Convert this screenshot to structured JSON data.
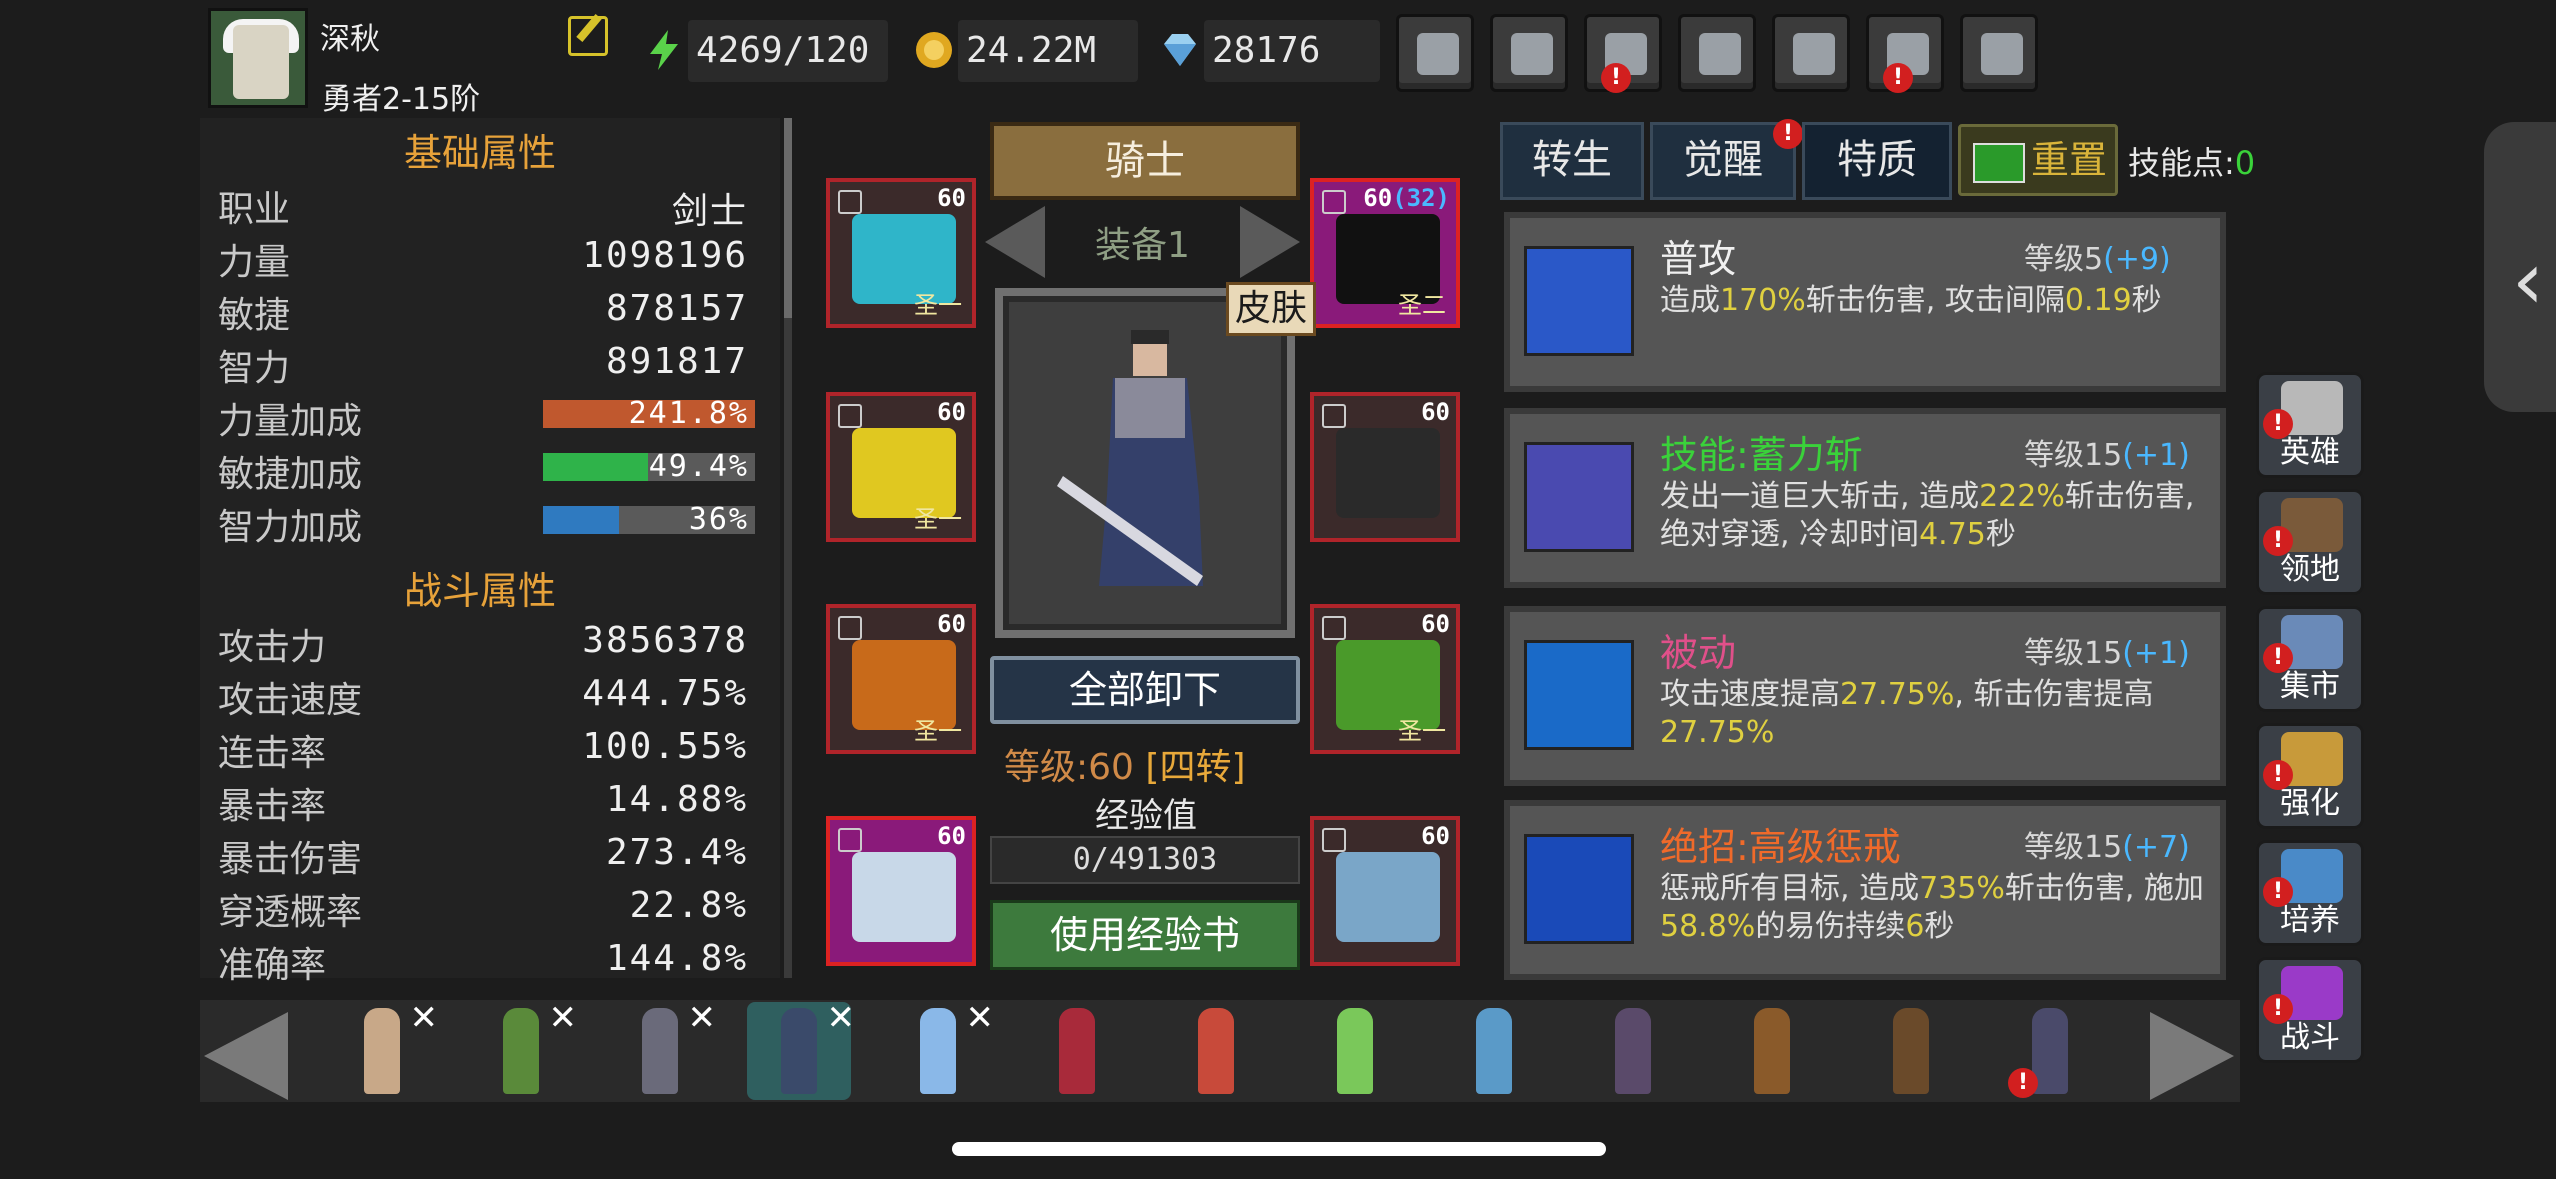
{
  "player": {
    "name": "深秋",
    "rank": "勇者2-15阶"
  },
  "resources": [
    {
      "icon": "energy-icon",
      "value": "4269/120"
    },
    {
      "icon": "gold-icon",
      "value": "24.22M"
    },
    {
      "icon": "diamond-icon",
      "value": "28176"
    }
  ],
  "top_buttons": [
    {
      "name": "shop-button",
      "icon": "cart-icon",
      "alert": false
    },
    {
      "name": "mail-button",
      "icon": "mail-icon",
      "alert": false
    },
    {
      "name": "gamepad-button",
      "icon": "gamepad-icon",
      "alert": true
    },
    {
      "name": "settings-button",
      "icon": "gear-icon",
      "alert": false
    },
    {
      "name": "color-wheel-button",
      "icon": "color-wheel-icon",
      "alert": false
    },
    {
      "name": "fireworks-button",
      "icon": "fireworks-icon",
      "alert": true
    },
    {
      "name": "battle-button",
      "icon": "crossed-swords-icon",
      "alert": false
    }
  ],
  "stats": {
    "basic_title": "基础属性",
    "basic": [
      {
        "label": "职业",
        "value": "剑士"
      },
      {
        "label": "力量",
        "value": "1098196"
      },
      {
        "label": "敏捷",
        "value": "878157"
      },
      {
        "label": "智力",
        "value": "891817"
      }
    ],
    "bonus": [
      {
        "label": "力量加成",
        "value": "241.8%",
        "fill": 1.0,
        "color": "#c0582e"
      },
      {
        "label": "敏捷加成",
        "value": "49.4%",
        "fill": 0.494,
        "color": "#2fb34a"
      },
      {
        "label": "智力加成",
        "value": "36%",
        "fill": 0.36,
        "color": "#2f7ac0"
      }
    ],
    "combat_title": "战斗属性",
    "combat": [
      {
        "label": "攻击力",
        "value": "3856378"
      },
      {
        "label": "攻击速度",
        "value": "444.75%"
      },
      {
        "label": "连击率",
        "value": "100.55%"
      },
      {
        "label": "暴击率",
        "value": "14.88%"
      },
      {
        "label": "暴击伤害",
        "value": "273.4%"
      },
      {
        "label": "穿透概率",
        "value": "22.8%"
      },
      {
        "label": "准确率",
        "value": "144.8%"
      }
    ]
  },
  "equipment": {
    "class_name": "骑士",
    "set_label": "装备1",
    "skin_label": "皮肤",
    "unequip_all": "全部卸下",
    "level_text": "等级:60",
    "level_tier": "[四转]",
    "exp_label": "经验值",
    "exp_value": "0/491303",
    "use_exp_book": "使用经验书",
    "slots": [
      {
        "name": "slot-helmet",
        "level": "60",
        "tier": "圣一",
        "epic": false,
        "icon": "crown-icon",
        "color": "#2fb5c9"
      },
      {
        "name": "slot-amulet",
        "level": "60",
        "level_extra": "(32)",
        "tier": "圣二",
        "epic": true,
        "icon": "amulet-icon",
        "color": "#111"
      },
      {
        "name": "slot-cloak",
        "level": "60",
        "tier": "圣一",
        "epic": false,
        "icon": "cloak-icon",
        "color": "#e0c820"
      },
      {
        "name": "slot-gloves",
        "level": "60",
        "tier": "",
        "epic": false,
        "icon": "gloves-icon",
        "color": "#2a2a2a"
      },
      {
        "name": "slot-legs",
        "level": "60",
        "tier": "圣一",
        "epic": false,
        "icon": "greaves-icon",
        "color": "#c86a1a"
      },
      {
        "name": "slot-ring",
        "level": "60",
        "tier": "圣一",
        "epic": false,
        "icon": "ring-icon",
        "color": "#4a9a2a"
      },
      {
        "name": "slot-boots",
        "level": "60",
        "tier": "",
        "epic": true,
        "icon": "boots-icon",
        "color": "#c8d8e8"
      },
      {
        "name": "slot-weapon",
        "level": "60",
        "tier": "",
        "epic": false,
        "icon": "sword-icon",
        "color": "#7aa6c8"
      }
    ]
  },
  "tabs": [
    {
      "label": "转生",
      "alert": false
    },
    {
      "label": "觉醒",
      "alert": true
    },
    {
      "label": "特质",
      "alert": false,
      "active": true
    }
  ],
  "reset_label": "重置",
  "skill_points_label": "技能点:",
  "skill_points": "0",
  "skills": [
    {
      "name": "普攻",
      "name_color": "#f0f0f0",
      "level": "等级5",
      "bonus": "(+9)",
      "icon_color": "#2a58c8",
      "desc": [
        [
          "造成",
          ""
        ],
        [
          "170%",
          "y"
        ],
        [
          "斩击伤害, 攻击间隔",
          ""
        ],
        [
          "0.19",
          "y"
        ],
        [
          "秒",
          ""
        ]
      ]
    },
    {
      "name": "技能:蓄力斩",
      "name_color": "#3ad23a",
      "level": "等级15",
      "bonus": "(+1)",
      "icon_color": "#4a4ab0",
      "desc": [
        [
          "发出一道巨大斩击, 造成",
          ""
        ],
        [
          "222%",
          "y"
        ],
        [
          "斩击伤害, 绝对穿透, 冷却时间",
          ""
        ],
        [
          "4.75",
          "y"
        ],
        [
          "秒",
          ""
        ]
      ]
    },
    {
      "name": "被动",
      "name_color": "#e0508a",
      "level": "等级15",
      "bonus": "(+1)",
      "icon_color": "#1a6ac8",
      "desc": [
        [
          "攻击速度提高",
          ""
        ],
        [
          "27.75%",
          "y"
        ],
        [
          ", 斩击伤害提高",
          ""
        ],
        [
          "27.75%",
          "y"
        ]
      ]
    },
    {
      "name": "绝招:高级惩戒",
      "name_color": "#f06a2a",
      "level": "等级15",
      "bonus": "(+7)",
      "icon_color": "#1a4ab8",
      "desc": [
        [
          "惩戒所有目标, 造成",
          ""
        ],
        [
          "735%",
          "y"
        ],
        [
          "斩击伤害, 施加",
          ""
        ],
        [
          "58.8%",
          "y"
        ],
        [
          "的易伤持续",
          ""
        ],
        [
          "6",
          "y"
        ],
        [
          "秒",
          ""
        ]
      ]
    }
  ],
  "side_menu": [
    {
      "label": "英雄",
      "icon": "helmet-icon",
      "color": "#b8b8b8"
    },
    {
      "label": "领地",
      "icon": "castle-icon",
      "color": "#7a5a3a"
    },
    {
      "label": "集市",
      "icon": "market-icon",
      "color": "#6a8ab8"
    },
    {
      "label": "强化",
      "icon": "crystal-icon",
      "color": "#c89a3a"
    },
    {
      "label": "培养",
      "icon": "chalice-icon",
      "color": "#4a8ac8"
    },
    {
      "label": "战斗",
      "icon": "portal-icon",
      "color": "#9a3ac8"
    }
  ],
  "roster": [
    {
      "name": "hero-amazon",
      "color": "#c8a888",
      "removable": true,
      "selected": false,
      "alert": false
    },
    {
      "name": "hero-archer",
      "color": "#5a8a3a",
      "removable": true,
      "selected": false,
      "alert": false
    },
    {
      "name": "hero-dark-knight",
      "color": "#6a6a7a",
      "removable": true,
      "selected": false,
      "alert": false
    },
    {
      "name": "hero-knight",
      "color": "#3a4a6a",
      "removable": true,
      "selected": true,
      "alert": false
    },
    {
      "name": "hero-ice-mage",
      "color": "#8ab8e8",
      "removable": true,
      "selected": false,
      "alert": false
    },
    {
      "name": "hero-red-mage",
      "color": "#a82a3a",
      "removable": false,
      "selected": false,
      "alert": false
    },
    {
      "name": "hero-gunner",
      "color": "#c84a3a",
      "removable": false,
      "selected": false,
      "alert": false
    },
    {
      "name": "hero-druid",
      "color": "#7ac85a",
      "removable": false,
      "selected": false,
      "alert": false
    },
    {
      "name": "hero-frost",
      "color": "#5a9ac8",
      "removable": false,
      "selected": false,
      "alert": false
    },
    {
      "name": "hero-wizard",
      "color": "#5a4a6a",
      "removable": false,
      "selected": false,
      "alert": false
    },
    {
      "name": "hero-warrior",
      "color": "#8a5a2a",
      "removable": false,
      "selected": false,
      "alert": false
    },
    {
      "name": "hero-ranger",
      "color": "#6a4a2a",
      "removable": false,
      "selected": false,
      "alert": false
    },
    {
      "name": "hero-assassin",
      "color": "#4a4a6a",
      "removable": false,
      "selected": false,
      "alert": true
    }
  ]
}
